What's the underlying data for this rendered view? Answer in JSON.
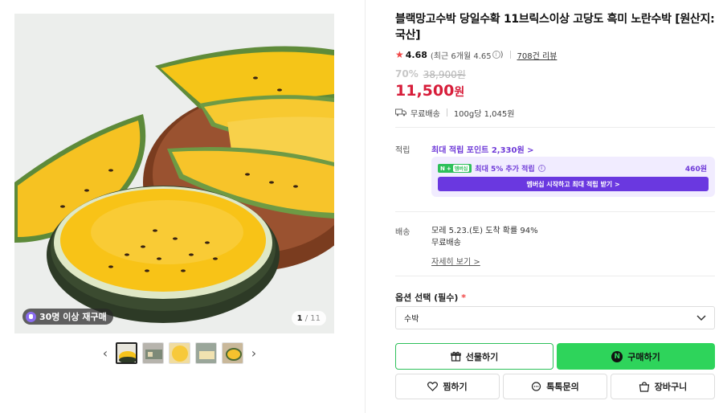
{
  "product": {
    "title": "블랙망고수박 당일수확 11브릭스이상 고당도 흑미 노란수박 [원산지: 국산]",
    "rating": "4.68",
    "rating_recent": "(최근 6개월 4.65",
    "review_link": "708건 리뷰",
    "discount": "70%",
    "original_price": "38,900원",
    "price": "11,500",
    "price_unit": "원",
    "shipping": "무료배송",
    "unit_price": "100g당 1,045원"
  },
  "gallery": {
    "rebuy_badge": "30명 이상 재구매",
    "page_current": "1",
    "page_total": "11"
  },
  "points": {
    "label": "적립",
    "max_points_link": "최대 적립 포인트 2,330원 >",
    "member_tag": "멤버십",
    "member_extra": "최대 5% 추가 적립",
    "member_amount": "460원",
    "member_button": "멤버십 시작하고 최대 적립 받기 >"
  },
  "delivery": {
    "label": "배송",
    "arrival": "모레 5.23.(토) 도착 확률 94%",
    "fee": "무료배송",
    "detail_link": "자세히 보기 >"
  },
  "option": {
    "label": "옵션 선택 (필수)",
    "required_mark": "*",
    "selected": "수박"
  },
  "buttons": {
    "gift": "선물하기",
    "buy": "구매하기",
    "wish": "찜하기",
    "talk": "톡톡문의",
    "cart": "장바구니"
  },
  "icons": [
    "star-icon",
    "info-icon",
    "truck-icon",
    "chevron-down-icon",
    "gift-icon",
    "naver-n-icon",
    "heart-icon",
    "chat-icon",
    "cart-icon",
    "chevron-left-icon",
    "chevron-right-icon"
  ],
  "colors": {
    "price_red": "#d71d3a",
    "naver_green": "#2ed45b",
    "membership_purple": "#6a38e0"
  }
}
